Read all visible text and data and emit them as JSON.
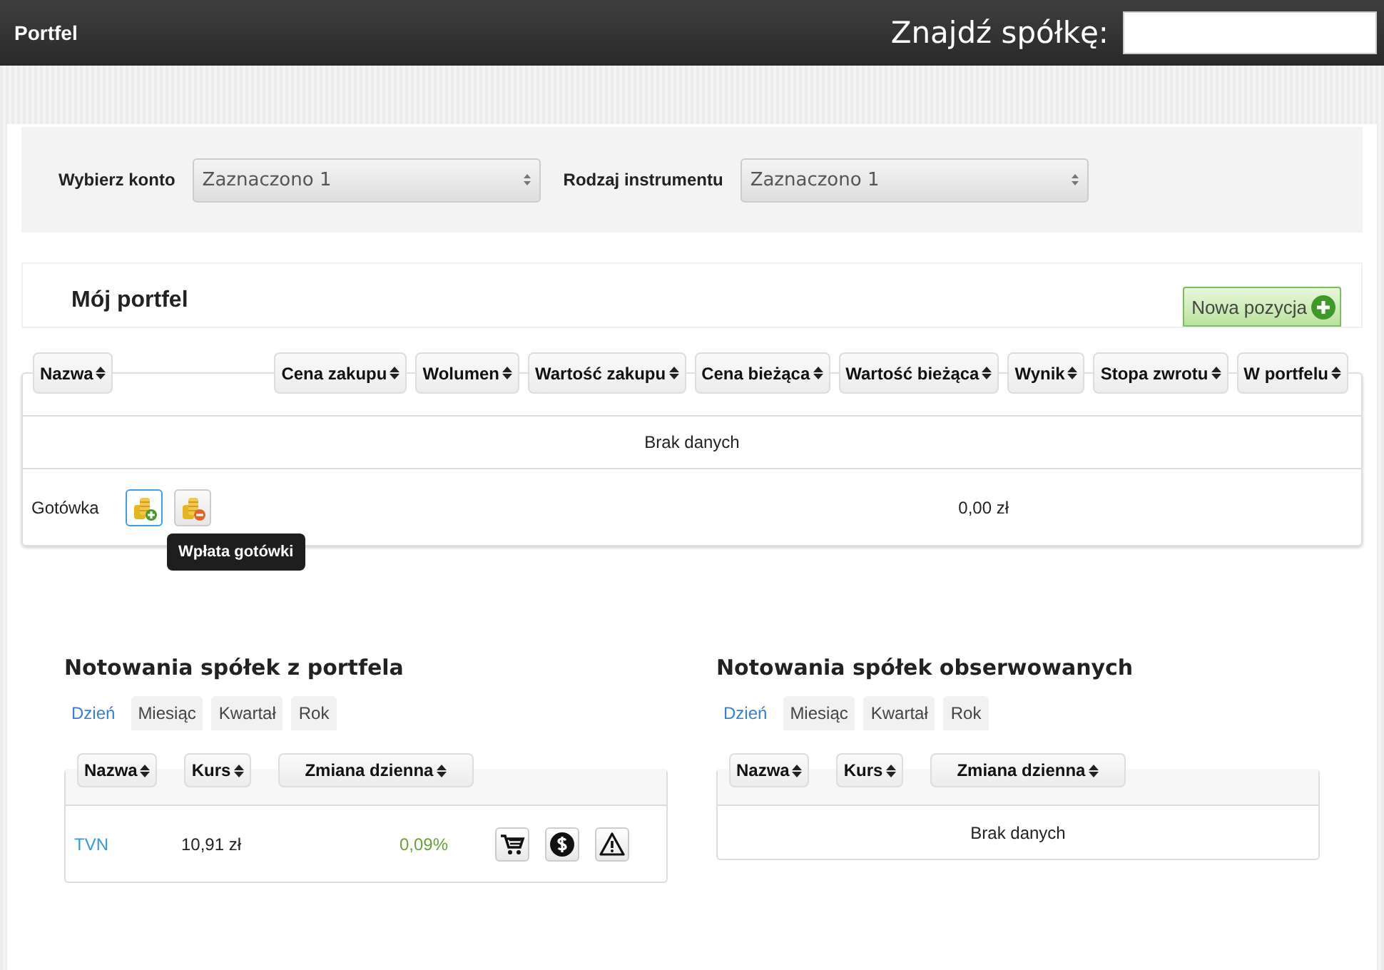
{
  "header": {
    "title": "Portfel",
    "search_label": "Znajdź spółkę:"
  },
  "filters": [
    {
      "label": "Wybierz konto",
      "value": "Zaznaczono 1"
    },
    {
      "label": "Rodzaj instrumentu",
      "value": "Zaznaczono 1"
    }
  ],
  "portfolio": {
    "title": "Mój portfel",
    "new_button": "Nowa pozycja",
    "columns": [
      "Nazwa",
      "Cena zakupu",
      "Wolumen",
      "Wartość zakupu",
      "Cena bieżąca",
      "Wartość bieżąca",
      "Wynik",
      "Stopa zwrotu",
      "W portfelu"
    ],
    "empty_text": "Brak danych",
    "cash": {
      "label": "Gotówka",
      "value": "0,00 zł",
      "actions": [
        {
          "kind": "deposit",
          "selected": true,
          "tooltip": "Wpłata gotówki"
        },
        {
          "kind": "withdraw",
          "selected": false
        }
      ]
    }
  },
  "quotes": [
    {
      "title": "Notowania spółek z portfela",
      "tabs": [
        {
          "label": "Dzień",
          "selected": true
        },
        {
          "label": "Miesiąc",
          "selected": false
        },
        {
          "label": "Kwartał",
          "selected": false
        },
        {
          "label": "Rok",
          "selected": false
        }
      ],
      "columns": [
        "Nazwa",
        "Kurs",
        "Zmiana dzienna"
      ],
      "rows": [
        {
          "name": "TVN",
          "price": "10,91 zł",
          "change": "0,09%",
          "actions": [
            {
              "kind": "cart"
            },
            {
              "kind": "dollar"
            },
            {
              "kind": "warning"
            }
          ]
        }
      ]
    },
    {
      "title": "Notowania spółek obserwowanych",
      "tabs": [
        {
          "label": "Dzień",
          "selected": true
        },
        {
          "label": "Miesiąc",
          "selected": false
        },
        {
          "label": "Kwartał",
          "selected": false
        },
        {
          "label": "Rok",
          "selected": false
        }
      ],
      "columns": [
        "Nazwa",
        "Kurs",
        "Zmiana dzienna"
      ],
      "empty_text": "Brak danych"
    }
  ]
}
